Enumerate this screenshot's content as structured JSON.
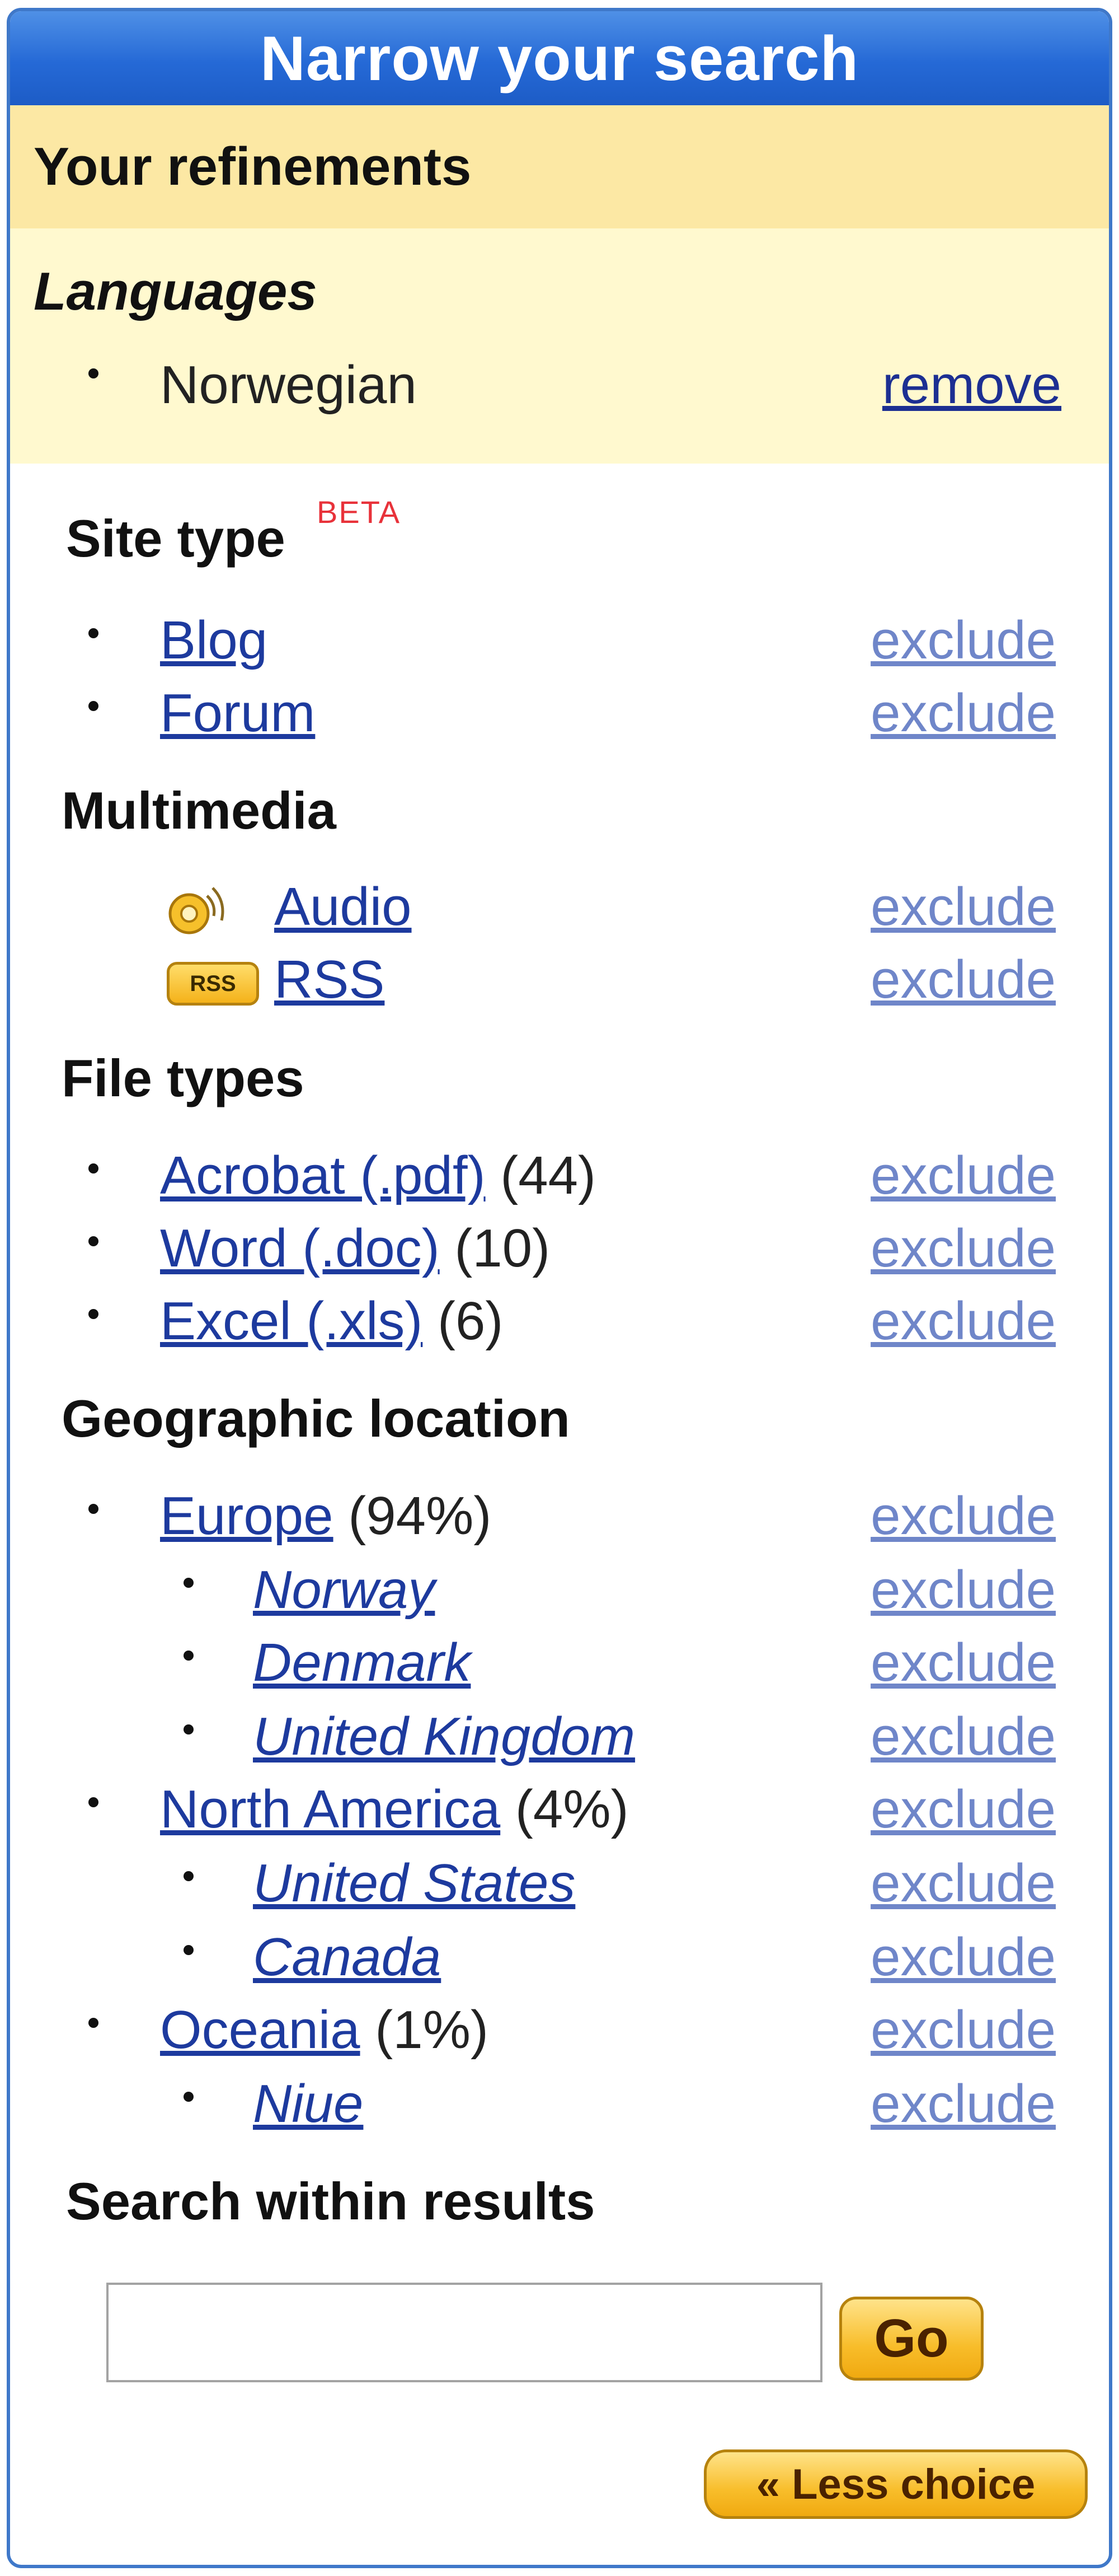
{
  "header": {
    "title": "Narrow your search"
  },
  "refinements": {
    "title": "Your refinements",
    "languages_title": "Languages",
    "language": "Norwegian",
    "remove_label": "remove"
  },
  "site_type": {
    "title": "Site type",
    "beta": "BETA",
    "items": [
      {
        "label": "Blog",
        "exclude": "exclude"
      },
      {
        "label": "Forum",
        "exclude": "exclude"
      }
    ]
  },
  "multimedia": {
    "title": "Multimedia",
    "items": [
      {
        "label": "Audio",
        "icon": "audio-icon",
        "exclude": "exclude"
      },
      {
        "label": "RSS",
        "icon": "rss-icon",
        "icon_text": "RSS",
        "exclude": "exclude"
      }
    ]
  },
  "file_types": {
    "title": "File types",
    "items": [
      {
        "label": "Acrobat (.pdf)",
        "count": "(44)",
        "exclude": "exclude"
      },
      {
        "label": "Word (.doc)",
        "count": "(10)",
        "exclude": "exclude"
      },
      {
        "label": "Excel (.xls)",
        "count": "(6)",
        "exclude": "exclude"
      }
    ]
  },
  "geo": {
    "title": "Geographic location",
    "items": [
      {
        "label": "Europe",
        "count": "(94%)",
        "exclude": "exclude"
      },
      {
        "label": "Norway",
        "exclude": "exclude"
      },
      {
        "label": "Denmark",
        "exclude": "exclude"
      },
      {
        "label": "United Kingdom",
        "exclude": "exclude"
      },
      {
        "label": "North America",
        "count": "(4%)",
        "exclude": "exclude"
      },
      {
        "label": "United States",
        "exclude": "exclude"
      },
      {
        "label": "Canada",
        "exclude": "exclude"
      },
      {
        "label": "Oceania",
        "count": "(1%)",
        "exclude": "exclude"
      },
      {
        "label": "Niue",
        "exclude": "exclude"
      }
    ]
  },
  "search": {
    "title": "Search within results",
    "value": "",
    "go_label": "Go",
    "less_choice_label": "« Less choice"
  },
  "colors": {
    "header_blue": "#2569d6",
    "refinement_bg": "#fce8a4",
    "link": "#1d3a9e",
    "exclude_link": "#6f86c9",
    "beta_red": "#e8323a",
    "button_gold": "#f8bd2a"
  }
}
